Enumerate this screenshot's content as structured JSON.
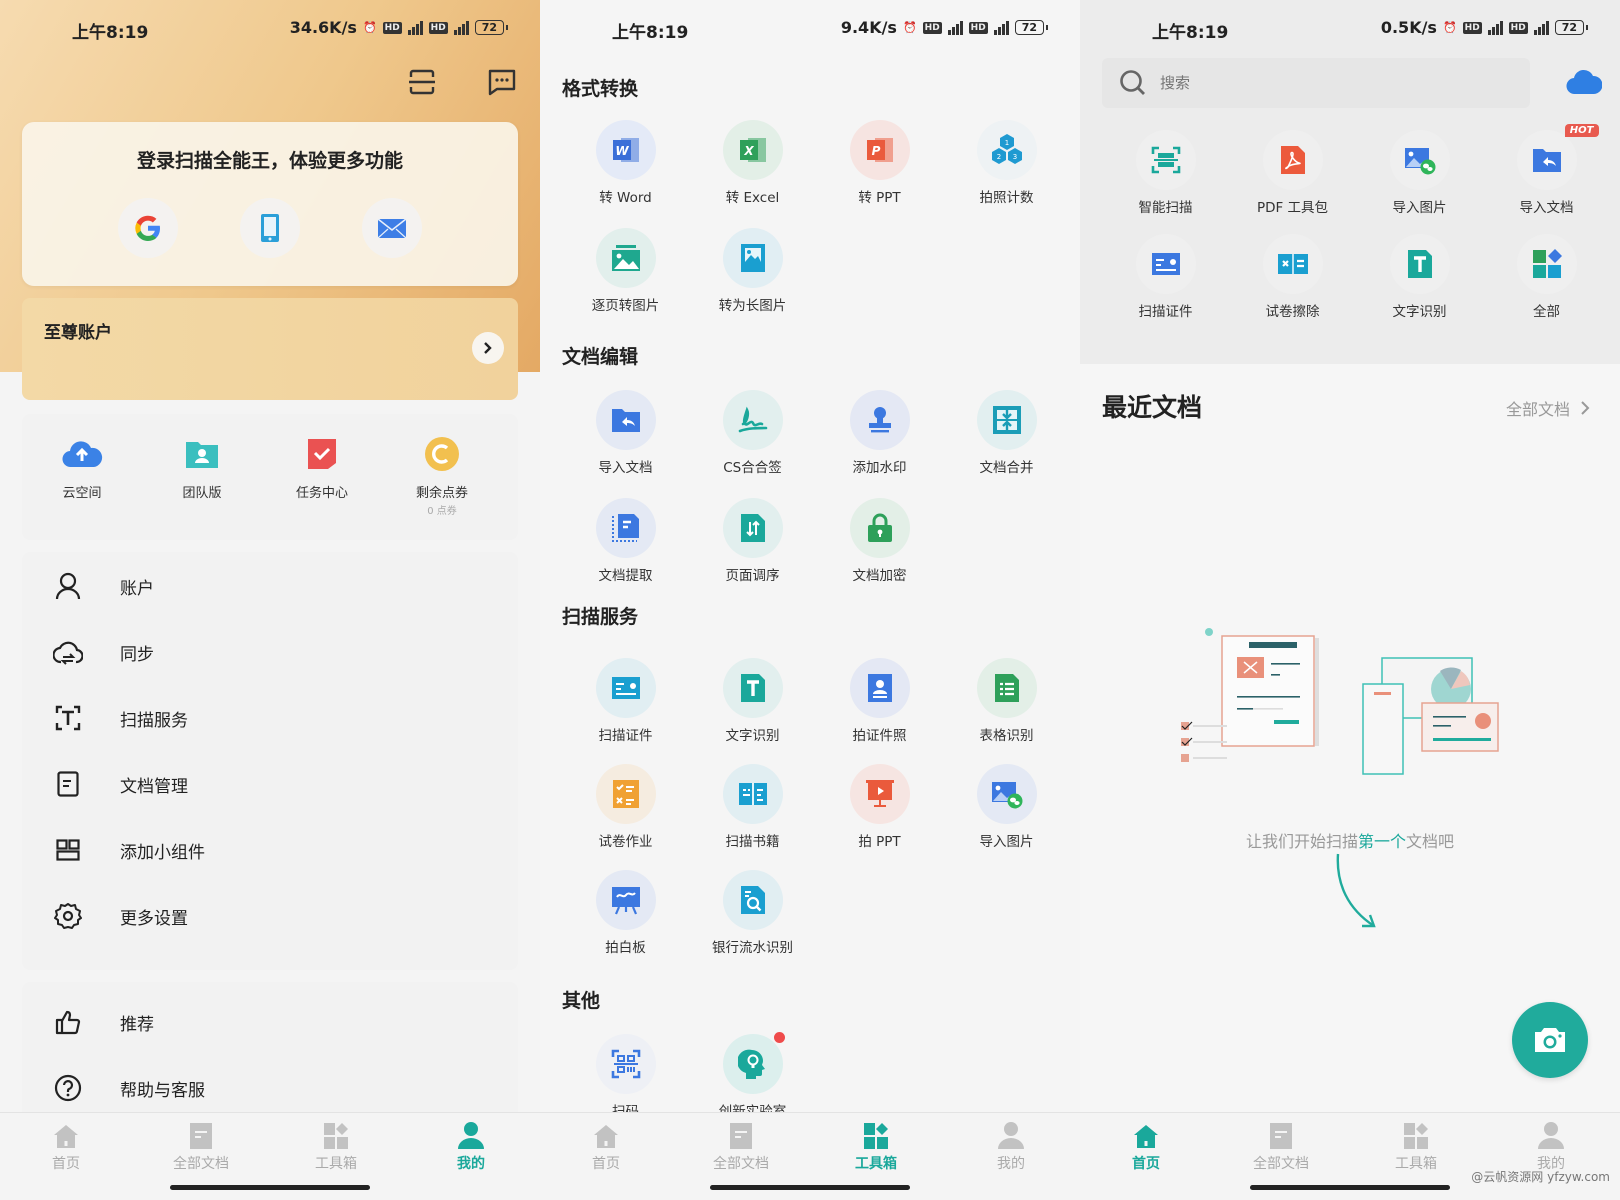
{
  "status_bars": [
    {
      "time": "上午8:19",
      "speed": "34.6K/s",
      "battery": "72",
      "network": "4G"
    },
    {
      "time": "上午8:19",
      "speed": "9.4K/s",
      "battery": "72",
      "network": "4G"
    },
    {
      "time": "上午8:19",
      "speed": "0.5K/s",
      "battery": "72",
      "network": "4G"
    }
  ],
  "me": {
    "login_title": "登录扫描全能王，体验更多功能",
    "login_options": [
      "google",
      "phone",
      "email"
    ],
    "vip_title": "至尊账户",
    "quick": [
      {
        "label": "云空间",
        "icon": "cloud-upload-icon"
      },
      {
        "label": "团队版",
        "icon": "team-folder-icon"
      },
      {
        "label": "任务中心",
        "icon": "task-check-icon"
      },
      {
        "label": "剩余点券",
        "icon": "coin-icon",
        "sub": "0 点券"
      }
    ],
    "menu": [
      {
        "label": "账户",
        "icon": "user-icon"
      },
      {
        "label": "同步",
        "icon": "cloud-sync-icon"
      },
      {
        "label": "扫描服务",
        "icon": "scan-text-icon"
      },
      {
        "label": "文档管理",
        "icon": "document-icon"
      },
      {
        "label": "添加小组件",
        "icon": "widget-icon"
      },
      {
        "label": "更多设置",
        "icon": "gear-icon"
      }
    ],
    "menu2": [
      {
        "label": "推荐",
        "icon": "thumbs-up-icon"
      },
      {
        "label": "帮助与客服",
        "icon": "help-icon"
      }
    ]
  },
  "tools": {
    "sections": [
      {
        "title": "格式转换",
        "items": [
          "转 Word",
          "转 Excel",
          "转 PPT",
          "拍照计数",
          "逐页转图片",
          "转为长图片"
        ]
      },
      {
        "title": "文档编辑",
        "items": [
          "导入文档",
          "CS合合签",
          "添加水印",
          "文档合并",
          "文档提取",
          "页面调序",
          "文档加密"
        ]
      },
      {
        "title": "扫描服务",
        "items": [
          "扫描证件",
          "文字识别",
          "拍证件照",
          "表格识别",
          "试卷作业",
          "扫描书籍",
          "拍 PPT",
          "导入图片",
          "拍白板",
          "银行流水识别"
        ]
      },
      {
        "title": "其他",
        "items": [
          "扫码",
          "创新实验室"
        ]
      }
    ]
  },
  "home": {
    "search_placeholder": "搜索",
    "tools": [
      "智能扫描",
      "PDF 工具包",
      "导入图片",
      "导入文档",
      "扫描证件",
      "试卷擦除",
      "文字识别",
      "全部"
    ],
    "hot_badge": "HOT",
    "recent_title": "最近文档",
    "recent_all": "全部文档",
    "empty_text_pre": "让我们开始扫描",
    "empty_text_hl": "第一个",
    "empty_text_post": "文档吧"
  },
  "nav": [
    "首页",
    "全部文档",
    "工具箱",
    "我的"
  ],
  "nav_active": {
    "panel_me": "我的",
    "panel_tools": "工具箱",
    "panel_home": "首页"
  },
  "colors": {
    "accent": "#1aa89b",
    "fab": "#20ab9c",
    "badge": "#ef4b4b",
    "gold": "#efc88c"
  },
  "watermark": "@云帆资源网 yfzyw.com"
}
